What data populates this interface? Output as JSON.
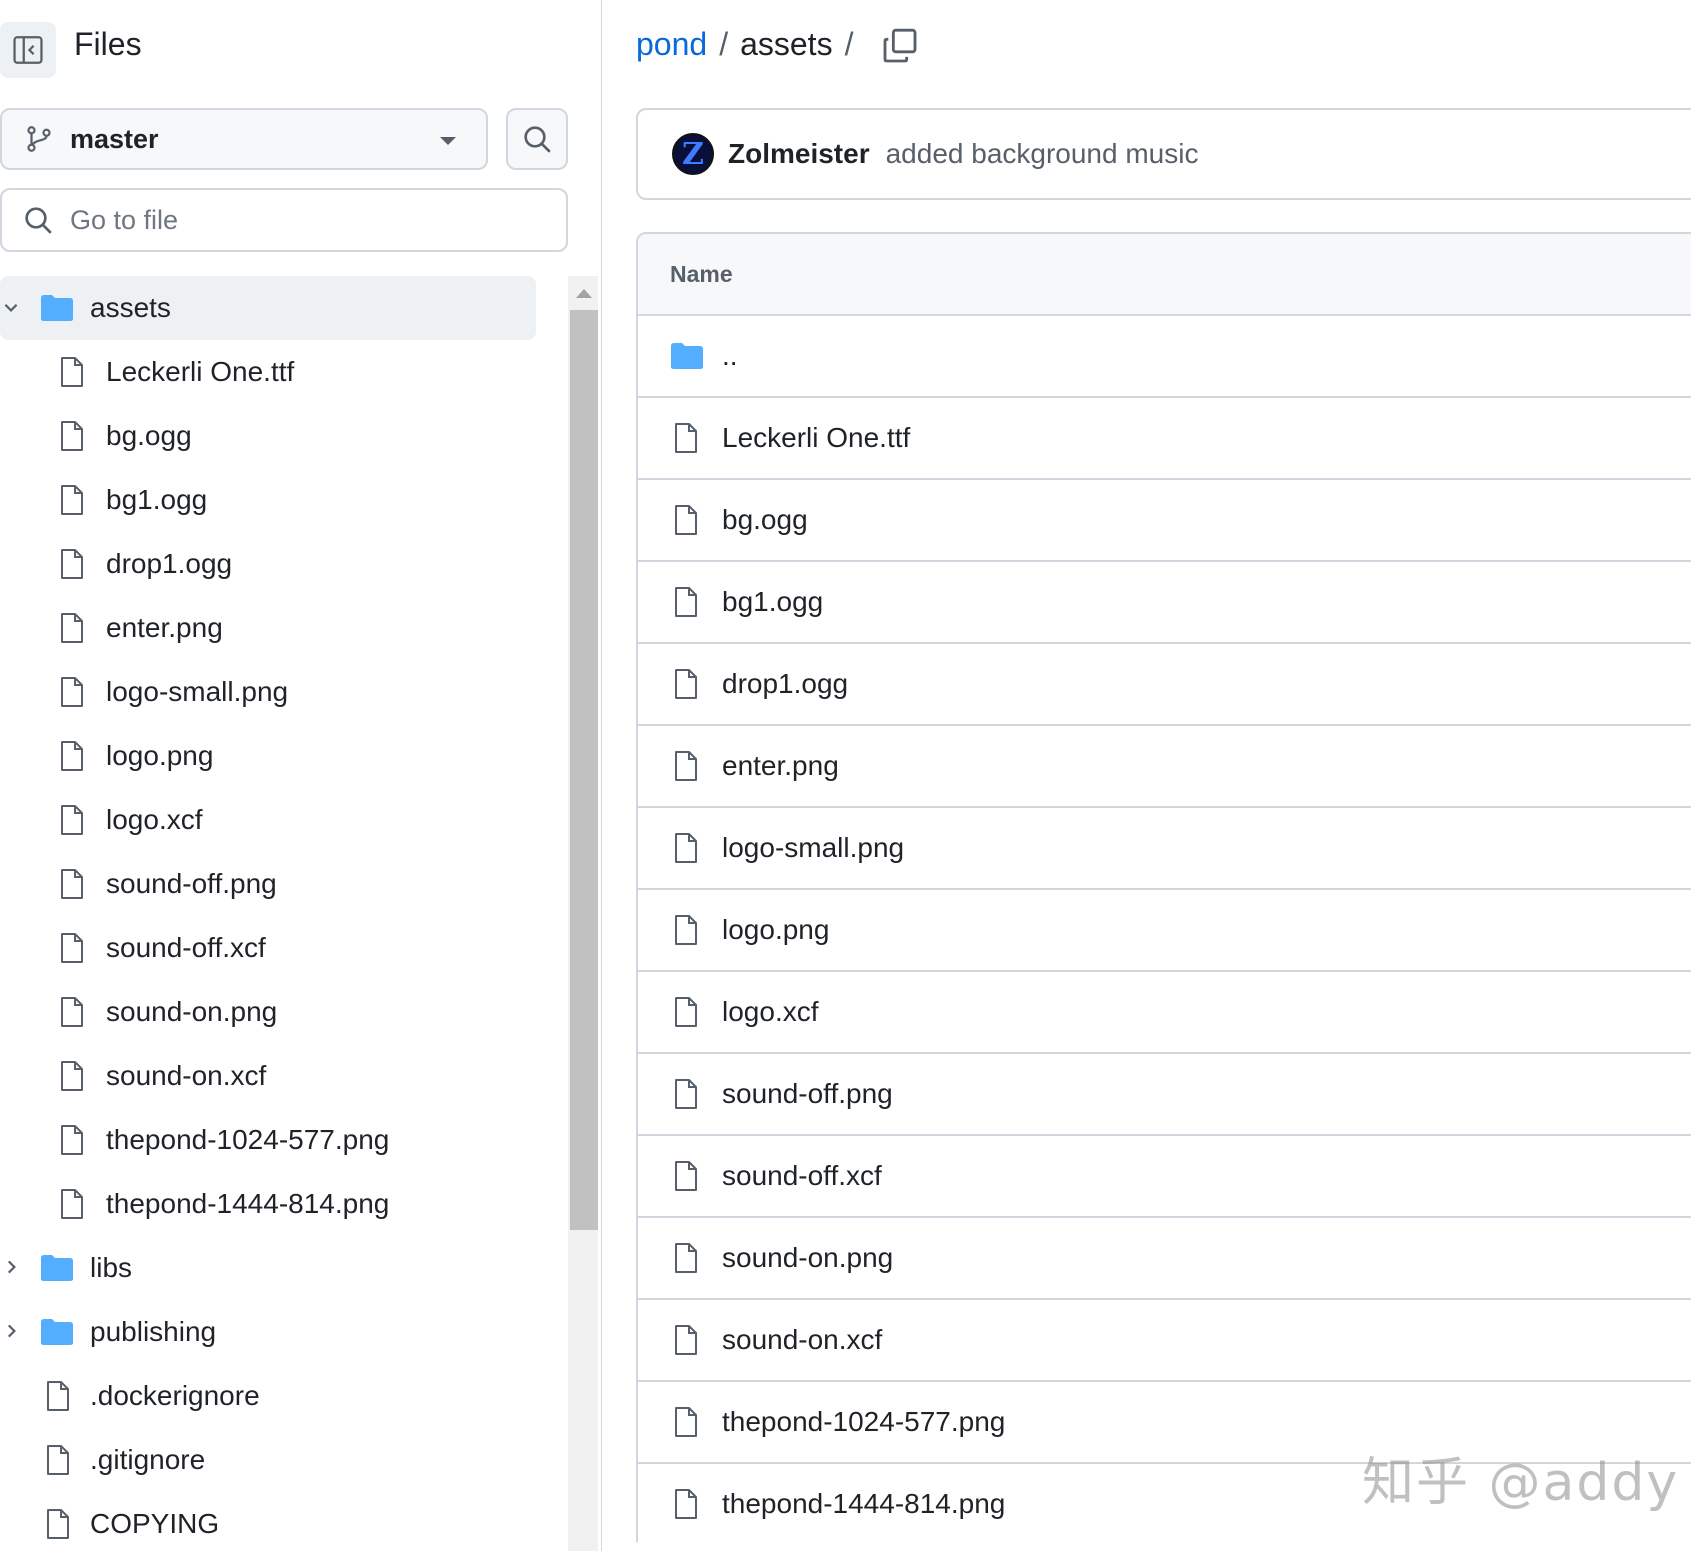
{
  "sidebar": {
    "title": "Files",
    "branch": "master",
    "goto_placeholder": "Go to file",
    "tree": [
      {
        "type": "folder",
        "label": "assets",
        "expanded": true,
        "selected": true,
        "level": 0
      },
      {
        "type": "file",
        "label": "Leckerli One.ttf",
        "level": 1
      },
      {
        "type": "file",
        "label": "bg.ogg",
        "level": 1
      },
      {
        "type": "file",
        "label": "bg1.ogg",
        "level": 1
      },
      {
        "type": "file",
        "label": "drop1.ogg",
        "level": 1
      },
      {
        "type": "file",
        "label": "enter.png",
        "level": 1
      },
      {
        "type": "file",
        "label": "logo-small.png",
        "level": 1
      },
      {
        "type": "file",
        "label": "logo.png",
        "level": 1
      },
      {
        "type": "file",
        "label": "logo.xcf",
        "level": 1
      },
      {
        "type": "file",
        "label": "sound-off.png",
        "level": 1
      },
      {
        "type": "file",
        "label": "sound-off.xcf",
        "level": 1
      },
      {
        "type": "file",
        "label": "sound-on.png",
        "level": 1
      },
      {
        "type": "file",
        "label": "sound-on.xcf",
        "level": 1
      },
      {
        "type": "file",
        "label": "thepond-1024-577.png",
        "level": 1
      },
      {
        "type": "file",
        "label": "thepond-1444-814.png",
        "level": 1
      },
      {
        "type": "folder",
        "label": "libs",
        "expanded": false,
        "level": 0
      },
      {
        "type": "folder",
        "label": "publishing",
        "expanded": false,
        "level": 0
      },
      {
        "type": "file",
        "label": ".dockerignore",
        "level": 0
      },
      {
        "type": "file",
        "label": ".gitignore",
        "level": 0
      },
      {
        "type": "file",
        "label": "COPYING",
        "level": 0
      }
    ]
  },
  "breadcrumb": {
    "repo": "pond",
    "separator": "/",
    "current": "assets"
  },
  "commit": {
    "avatar_letter": "Z",
    "author": "Zolmeister",
    "message": "added background music"
  },
  "table": {
    "header": "Name",
    "rows": [
      {
        "type": "folder",
        "label": ".."
      },
      {
        "type": "file",
        "label": "Leckerli One.ttf"
      },
      {
        "type": "file",
        "label": "bg.ogg"
      },
      {
        "type": "file",
        "label": "bg1.ogg"
      },
      {
        "type": "file",
        "label": "drop1.ogg"
      },
      {
        "type": "file",
        "label": "enter.png"
      },
      {
        "type": "file",
        "label": "logo-small.png"
      },
      {
        "type": "file",
        "label": "logo.png"
      },
      {
        "type": "file",
        "label": "logo.xcf"
      },
      {
        "type": "file",
        "label": "sound-off.png"
      },
      {
        "type": "file",
        "label": "sound-off.xcf"
      },
      {
        "type": "file",
        "label": "sound-on.png"
      },
      {
        "type": "file",
        "label": "sound-on.xcf"
      },
      {
        "type": "file",
        "label": "thepond-1024-577.png"
      },
      {
        "type": "file",
        "label": "thepond-1444-814.png"
      }
    ]
  },
  "watermark": "知乎 @addy",
  "colors": {
    "link": "#0969da",
    "folder": "#54aeff",
    "border": "#d0d7de",
    "text": "#1f2328",
    "muted": "#57606a"
  }
}
